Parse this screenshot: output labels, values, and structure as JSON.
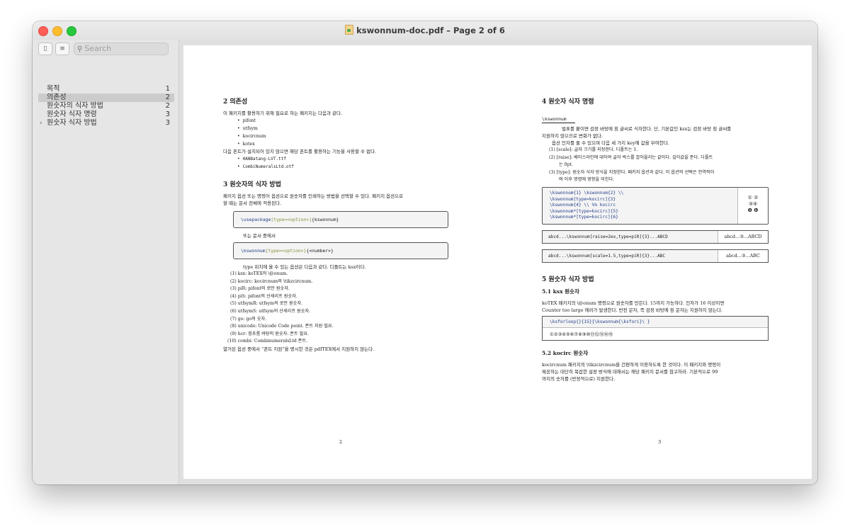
{
  "window": {
    "title": "kswonnum-doc.pdf – Page 2 of 6"
  },
  "sidebar": {
    "search_placeholder": "Search",
    "toc": [
      {
        "label": "목적",
        "page": "1"
      },
      {
        "label": "의존성",
        "page": "2"
      },
      {
        "label": "원숫자의 식자 방법",
        "page": "2"
      },
      {
        "label": "원숫자 식자 명령",
        "page": "3"
      },
      {
        "label": "원숫자 식자 방법",
        "page": "3"
      }
    ]
  },
  "left": {
    "s2_title": "2   의존성",
    "s2_intro": "이 패키지를 활용하기 위해 필요로 하는 패키지는 다음과 같다.",
    "deps": [
      "pifont",
      "utfsym",
      "kocircnum",
      "kotex"
    ],
    "fonts_intro": "다음 폰트가 설치되어 있지 않으면 해당 폰트를 활용하는 기능을 사용할 수 없다.",
    "fonts": [
      "HANBatang-LVT.ttf",
      "CombiNumeralsLtd.otf"
    ],
    "s3_title": "3   원숫자의 식자 방법",
    "s3_p1": "패키지 옵션 또는 명령어 옵션으로 원숫자를 인쇄하는 방법을 선택할 수 있다. 패키지 옵션으로",
    "s3_p2": "할 때는 문서 전체에 적용된다.",
    "code1_a": "\\usepackage",
    "code1_b": "[type=<option>]",
    "code1_c": "{kswonnum}",
    "or_text": "또는 문서 중에서",
    "code2_a": "\\kswonnum",
    "code2_b": "[type=<option>]",
    "code2_c": "{<number>}",
    "type_intro": "type 위치에 올 수 있는 옵션은 다음과 같다. 디폴트는 ksx이다.",
    "types": [
      "(1)  ksx: koTEX의 \\@onum.",
      "(2)  kocirc: kocircnum의 \\tikzcircnum.",
      "(3)  piR: pifont의 로만 원숫자.",
      "(4)  piS: pifont의 산세리프 원숫자.",
      "(5)  utfsymR: utfsym의 로만 원숫자.",
      "(6)  utfsymS: utfsym의 산세리프 원숫자.",
      "(7)  go: go의 숫자.",
      "(8)  unicode: Unicode Code point. 폰트 지원 필요.",
      "(9)  hcr: 함초롬 바탕의 원숫자. 폰트 필요.",
      "(10)  combi: CombinumeralsLtd 폰트."
    ],
    "footer_note": "열거된 옵션 중에서 “폰트 지원”을 명시한 것은 pdfTEX에서 지원하지 않는다.",
    "page_no": "2"
  },
  "right": {
    "s4_title": "4   원숫자 식자 명령",
    "cmd_label": "\\kswonnum",
    "s4_p1": "벌표를 붙이면 검정 바탕에 흰 글씨로 식자한다. 단, 기본값인 ksx는 검정 바탕 흰 글씨를",
    "s4_p2": "지원하지 않으므로 변화가 없다.",
    "s4_p3": "옵션 인자를 줄 수 있으며 다음 세 가지 key에 값을 부여한다.",
    "keys": [
      "(1)  [scale]: 글자 크기를 지정한다. 디폴트는 1.",
      "(2)  [raise]: 베이스라인에 대하여 글자 박스를 끌어올리는 값이다. 길이값을 준다. 디폴트",
      "      는 0pt.",
      "(3)  [type]: 원숫자 식자 방식을 지정한다. 패키지 옵션과 같다. 이 옵션의 선택은 전역적이",
      "      며 이후 명령에 영향을 미친다."
    ],
    "example_lines": [
      "\\kswonnum{1} \\kswonnum{2} \\\\",
      "\\kswonnum[type=kocirc]{3}",
      "\\kswonnum{4} \\\\ %% kocirc",
      "\\kswonnum*[type=kocirc]{5}",
      "\\kswonnum*[type=kocirc]{6}"
    ],
    "example_output": [
      "① ②",
      "③④",
      "❺ ❻"
    ],
    "raise_code": "abcd...\\kswonnum[raise=2ex,type=piR]{3}...ABCD",
    "raise_out": "abcd...③...ABCD",
    "scale_code": "abcd...\\kswonnum[scale=1.5,type=piR]{3}...ABC",
    "scale_out": "abcd...③...ABC",
    "s5_title": "5   원숫자 식자 방법",
    "s51_title": "5.1   ksx 원숫자",
    "s51_p1": "koTEX 패키지의 \\@onum 명령으로 원숫자를 만든다. 15까지 가능하다. 인자가 16 이상이면",
    "s51_p2": "Counter too large 에러가 발생한다. 반전 문자, 즉 검정 바탕에 흰 문자는 지원하지 않는다.",
    "loop_code": "\\ksforloop{}{15}{\\kswonnum{\\ksfori}\\ }",
    "loop_out": "①②③④⑤⑥⑦⑧⑨⑩⑪⑫⑬⑭⑮",
    "s52_title": "5.2   kocirc 원숫자",
    "s52_p1": "kocircnum 패키지의 \\tikzcircnum을 간편하게 이용하도록 한 것이다. 이 패키지와 명령이",
    "s52_p2": "제공하는 대단히 복잡한 설정 방식에 대해서는 해당 패키지 문서를 참고하라. 기본적으로 99",
    "s52_p3": "까지의 숫자를 (반정적으로) 지원한다.",
    "page_no": "3"
  }
}
